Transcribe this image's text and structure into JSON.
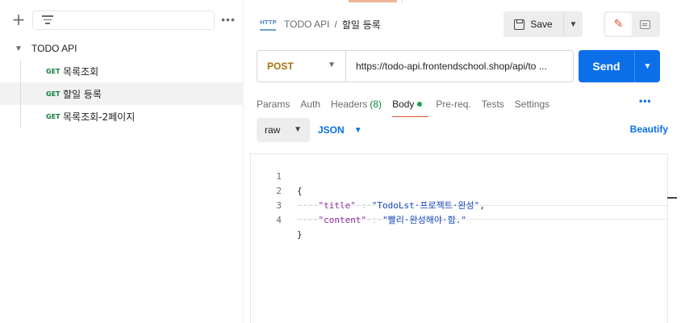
{
  "sidebar": {
    "plus_glyph": "+",
    "more_glyph": "•••",
    "collection": {
      "name": "TODO API",
      "items": [
        {
          "method": "GET",
          "name": "목록조회"
        },
        {
          "method": "GET",
          "name": "할일 등록"
        },
        {
          "method": "GET",
          "name": "목록조회-2페이지"
        }
      ]
    }
  },
  "header": {
    "http_icon_text": "HTTP",
    "breadcrumb_parent": "TODO API",
    "breadcrumb_sep": "/",
    "breadcrumb_current": "할일 등록",
    "save_label": "Save"
  },
  "request": {
    "method": "POST",
    "url": "https://todo-api.frontendschool.shop/api/to ...",
    "send_label": "Send",
    "tabs": [
      {
        "label": "Params"
      },
      {
        "label": "Auth"
      },
      {
        "label": "Headers",
        "count": "(8)"
      },
      {
        "label": "Body"
      },
      {
        "label": "Pre-req."
      },
      {
        "label": "Tests"
      },
      {
        "label": "Settings"
      }
    ],
    "more_glyph": "•••"
  },
  "body_options": {
    "mode": "raw",
    "language": "JSON",
    "beautify_label": "Beautify"
  },
  "editor": {
    "lines": [
      {
        "n": "1",
        "text": "{"
      },
      {
        "n": "2",
        "ws": "····",
        "key": "\"title\"",
        "sep": "·:·",
        "value": "\"TodoLst·프로젝트·완성\"",
        "end": ","
      },
      {
        "n": "3",
        "ws": "····",
        "key": "\"content\"",
        "sep": "·:·",
        "value": "\"빨리·완성해야·함.\"",
        "end": ""
      },
      {
        "n": "4",
        "text": "}"
      }
    ]
  },
  "colors": {
    "accent_blue": "#0b6fe8",
    "active_orange": "#e0572b",
    "get_green": "#0f7e3b",
    "post_amber": "#a8720b"
  },
  "icons": [
    "plus-icon",
    "filter-icon",
    "more-icon",
    "chevron-down-icon",
    "http-icon",
    "save-icon",
    "pencil-icon",
    "comment-icon"
  ]
}
